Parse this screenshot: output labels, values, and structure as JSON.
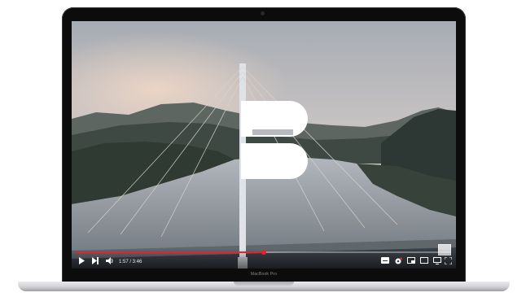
{
  "device": {
    "model_label": "MacBook Pro"
  },
  "player": {
    "time_display": "1:57 / 3:46",
    "progress": 0.5,
    "accent_color": "#e3242b",
    "controls": {
      "play": "play-icon",
      "next": "next-icon",
      "volume": "volume-icon",
      "subtitles": "subtitles-icon",
      "settings": "gear-icon",
      "miniplayer": "miniplayer-icon",
      "theater": "theater-mode-icon",
      "cast": "cast-icon",
      "fullscreen": "fullscreen-icon"
    }
  },
  "video": {
    "scene": "bridge-at-dusk",
    "logo": "B"
  }
}
